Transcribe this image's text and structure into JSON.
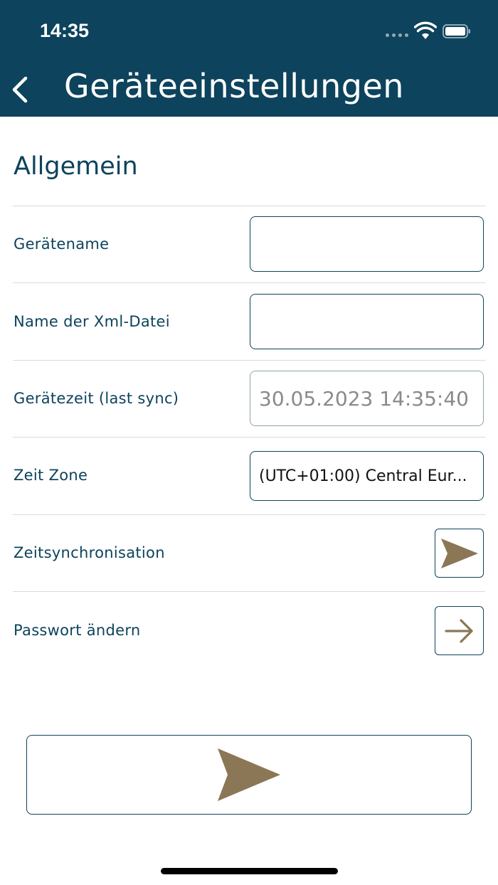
{
  "status_bar": {
    "time": "14:35",
    "icons": [
      "cellular-signal-icon",
      "wifi-icon",
      "battery-icon"
    ]
  },
  "nav": {
    "title": "Geräteeinstellungen",
    "back_icon": "chevron-left-icon"
  },
  "section": {
    "title": "Allgemein"
  },
  "rows": {
    "device_name": {
      "label": "Gerätename",
      "value": ""
    },
    "xml_file": {
      "label": "Name der Xml-Datei",
      "value": ""
    },
    "device_time": {
      "label": "Gerätezeit (last sync)",
      "value": "30.05.2023 14:35:40"
    },
    "time_zone": {
      "label": "Zeit Zone",
      "value": "(UTC+01:00) Central Eur..."
    },
    "time_sync": {
      "label": "Zeitsynchronisation",
      "icon": "send-icon"
    },
    "change_password": {
      "label": "Passwort ändern",
      "icon": "arrow-right-icon"
    }
  },
  "submit": {
    "icon": "send-icon"
  },
  "colors": {
    "primary": "#0d435c",
    "accent": "#8b7755",
    "divider": "#d9d9d9",
    "disabled_text": "#8a8a8a"
  }
}
